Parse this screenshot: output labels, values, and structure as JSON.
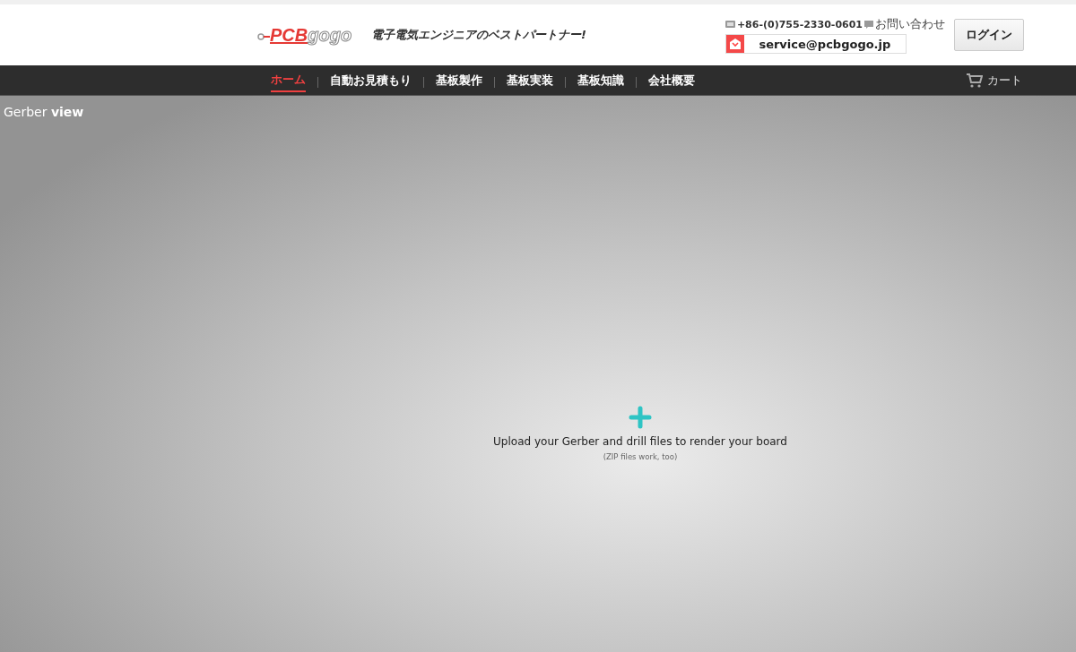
{
  "header": {
    "logo": {
      "part_1": "PCB",
      "part_2": "gogo"
    },
    "tagline": "電子電気エンジニアのベストパートナー!",
    "phone": "+86-(0)755-2330-0601",
    "contact_link": "お問い合わせ",
    "email": "service@pcbgogo.jp",
    "login_button": "ログイン"
  },
  "nav": {
    "items": [
      {
        "label": "ホーム",
        "selected": true
      },
      {
        "label": "自動お見積もり",
        "selected": false
      },
      {
        "label": "基板製作",
        "selected": false
      },
      {
        "label": "基板実装",
        "selected": false
      },
      {
        "label": "基板知識",
        "selected": false
      },
      {
        "label": "会社概要",
        "selected": false
      }
    ],
    "cart": "カート"
  },
  "viewer": {
    "title": "Gerber **view**",
    "upload_text": "Upload your Gerber and drill files to render your board",
    "upload_hint": "(ZIP files work, too)"
  }
}
